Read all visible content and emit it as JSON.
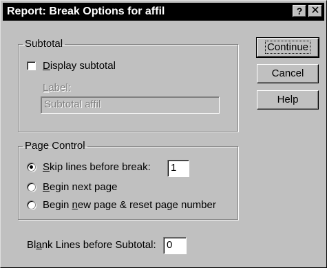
{
  "window": {
    "title": "Report: Break Options for affil",
    "help_button": "?",
    "close_button": "✕"
  },
  "subtotal": {
    "group_label": "Subtotal",
    "display_checkbox": {
      "pre": "",
      "accel": "D",
      "post": "isplay subtotal",
      "checked": false
    },
    "label_caption": {
      "accel": "L",
      "post": "abel:"
    },
    "label_value": "Subtotal affil"
  },
  "page_control": {
    "group_label": "Page Control",
    "options": [
      {
        "pre": "",
        "accel": "S",
        "post": "kip lines before break:",
        "selected": true
      },
      {
        "pre": "",
        "accel": "B",
        "post": "egin next page",
        "selected": false
      },
      {
        "pre": "Begin ",
        "accel": "n",
        "post": "ew page & reset page number",
        "selected": false
      }
    ],
    "skip_lines_value": "1"
  },
  "blank_lines": {
    "label_pre": "Bl",
    "label_accel": "a",
    "label_post": "nk Lines before Subtotal:",
    "value": "0"
  },
  "buttons": {
    "continue": "Continue",
    "cancel": "Cancel",
    "help": "Help"
  }
}
